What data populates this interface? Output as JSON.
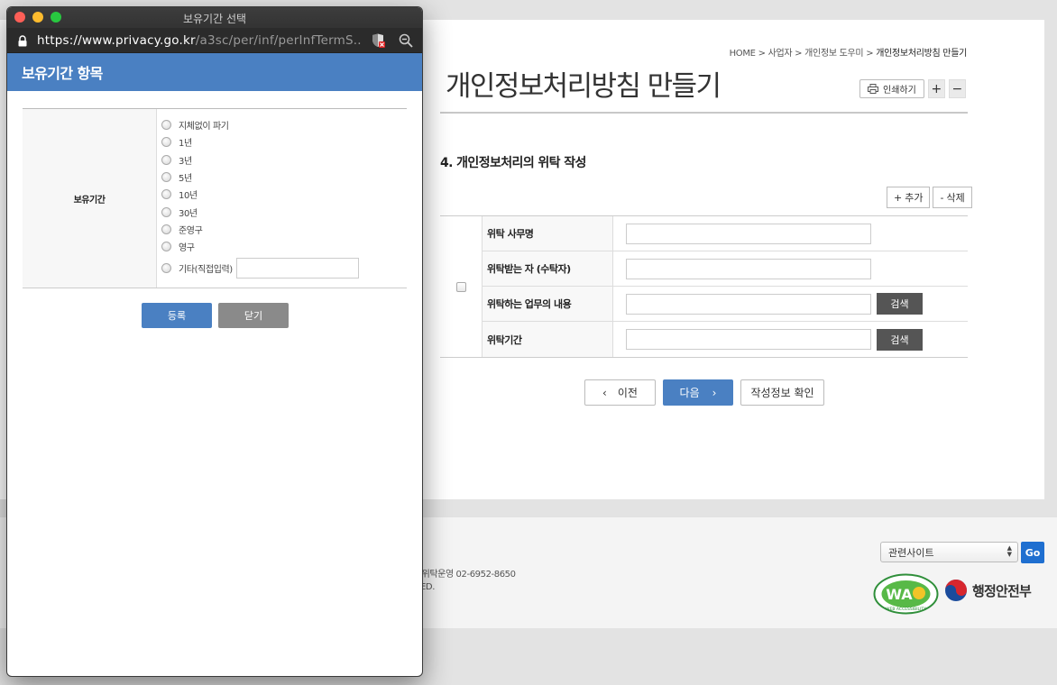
{
  "page": {
    "breadcrumb": {
      "home": "HOME",
      "sep1": ">",
      "c1": "사업자",
      "sep2": ">",
      "c2": "개인정보 도우미",
      "sep3": ">",
      "current": "개인정보처리방침 만들기"
    },
    "title": "개인정보처리방침 만들기",
    "print_label": "인쇄하기",
    "zoom_in": "+",
    "zoom_out": "−",
    "section_title": "4. 개인정보처리의 위탁 작성",
    "add_label": "추가",
    "delete_label": "삭제",
    "rows": [
      {
        "label": "위탁 사무명"
      },
      {
        "label": "위탁받는 자 (수탁자)"
      },
      {
        "label": "위탁하는 업무의 내용",
        "button": "검색"
      },
      {
        "label": "위탁기간",
        "button": "검색"
      }
    ],
    "prev_label": "이전",
    "next_label": "다음",
    "confirm_label": "작성정보 확인"
  },
  "footer": {
    "line1": "원 위탁운영 02-6952-8650",
    "line2": "ED.",
    "site_select": "관련사이트",
    "go_label": "Go",
    "wa_text": "WA",
    "wa_ring": "WEB ACCESSIBILITY",
    "mois": "행정안전부"
  },
  "popup": {
    "window_title": "보유기간 선택",
    "url_host": "https://www.privacy.go.kr",
    "url_path": "/a3sc/per/inf/perInfTermS...",
    "header": "보유기간 항목",
    "field_label": "보유기간",
    "options": [
      "지체없이 파기",
      "1년",
      "3년",
      "5년",
      "10년",
      "30년",
      "준영구",
      "영구"
    ],
    "other_label": "기타(직접입력)",
    "register_label": "등록",
    "close_label": "닫기"
  }
}
